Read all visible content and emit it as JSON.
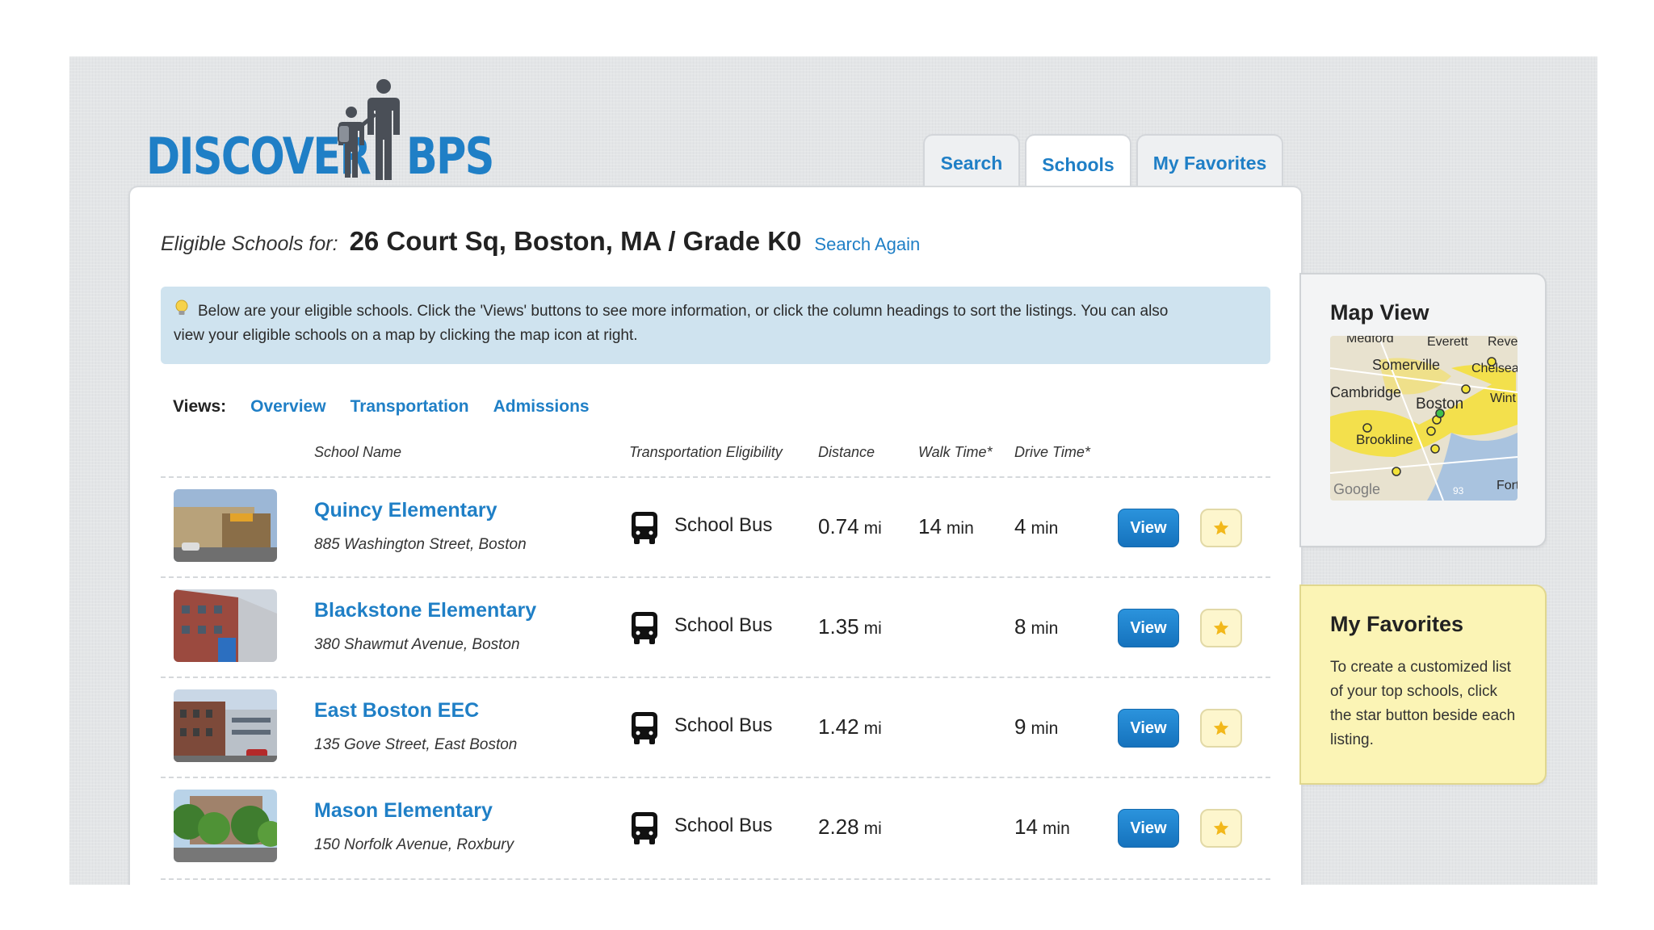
{
  "logo": {
    "left": "DISCOVER",
    "right": "BPS"
  },
  "tabs": [
    {
      "label": "Search",
      "active": false
    },
    {
      "label": "Schools",
      "active": true
    },
    {
      "label": "My Favorites",
      "active": false
    }
  ],
  "header": {
    "eligible_label": "Eligible Schools for:",
    "address_grade": "26 Court Sq, Boston, MA / Grade K0",
    "search_again": "Search Again"
  },
  "tip": {
    "line1": "Below are your eligible schools. Click the 'Views' buttons to see more information, or click the column headings to sort the listings. You can also",
    "line2": "view your eligible schools on a map by clicking the map icon at right."
  },
  "views": {
    "label": "Views:",
    "items": [
      "Overview",
      "Transportation",
      "Admissions"
    ]
  },
  "columns": [
    "School Name",
    "Transportation Eligibility",
    "Distance",
    "Walk Time*",
    "Drive Time*"
  ],
  "schools": [
    {
      "name": "Quincy Elementary",
      "address": "885 Washington Street, Boston",
      "transport": "School Bus",
      "distance": "0.74",
      "distance_unit": "mi",
      "walk": "14",
      "walk_unit": "min",
      "drive": "4",
      "drive_unit": "min",
      "view_label": "View"
    },
    {
      "name": "Blackstone Elementary",
      "address": "380 Shawmut Avenue, Boston",
      "transport": "School Bus",
      "distance": "1.35",
      "distance_unit": "mi",
      "walk": "",
      "walk_unit": "",
      "drive": "8",
      "drive_unit": "min",
      "view_label": "View"
    },
    {
      "name": "East Boston EEC",
      "address": "135 Gove Street, East Boston",
      "transport": "School Bus",
      "distance": "1.42",
      "distance_unit": "mi",
      "walk": "",
      "walk_unit": "",
      "drive": "9",
      "drive_unit": "min",
      "view_label": "View"
    },
    {
      "name": "Mason Elementary",
      "address": "150 Norfolk Avenue, Roxbury",
      "transport": "School Bus",
      "distance": "2.28",
      "distance_unit": "mi",
      "walk": "",
      "walk_unit": "",
      "drive": "14",
      "drive_unit": "min",
      "view_label": "View"
    }
  ],
  "map_view": {
    "title": "Map View",
    "labels": [
      "Medford",
      "Everett",
      "Reve",
      "Somerville",
      "Chelsea",
      "Cambridge",
      "Boston",
      "Wint",
      "Brookline",
      "Google",
      "93",
      "Fort"
    ]
  },
  "favorites": {
    "title": "My Favorites",
    "text": "To create a customized list of your top schools, click the star button beside each listing."
  },
  "colors": {
    "accent": "#1f7fc6",
    "tip_bg": "#cfe3ef",
    "fav_bg": "#fbf4b5",
    "star": "#f2b81b"
  },
  "icons": [
    "bulb-icon",
    "bus-icon",
    "star-icon"
  ]
}
